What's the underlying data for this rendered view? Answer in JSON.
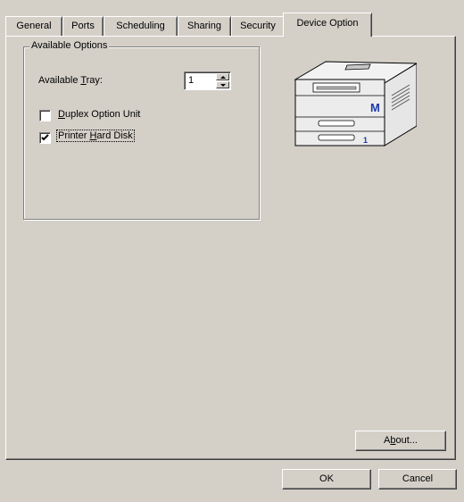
{
  "tabs": [
    {
      "label": "General"
    },
    {
      "label": "Ports"
    },
    {
      "label": "Scheduling"
    },
    {
      "label": "Sharing"
    },
    {
      "label": "Security"
    },
    {
      "label": "Device Option"
    }
  ],
  "options": {
    "group_title": "Available Options",
    "tray_label_prefix": "Available ",
    "tray_label_access": "T",
    "tray_label_suffix": "ray:",
    "tray_value": "1",
    "duplex": {
      "access": "D",
      "rest": "uplex Option Unit",
      "checked": false
    },
    "hard_disk": {
      "prefix": "Printer ",
      "access": "H",
      "rest": "ard Disk",
      "checked": true
    }
  },
  "printer_image": {
    "tray_number": "1",
    "brand_letter": "M"
  },
  "buttons": {
    "about_prefix": "A",
    "about_access": "b",
    "about_suffix": "out...",
    "ok": "OK",
    "cancel": "Cancel"
  }
}
